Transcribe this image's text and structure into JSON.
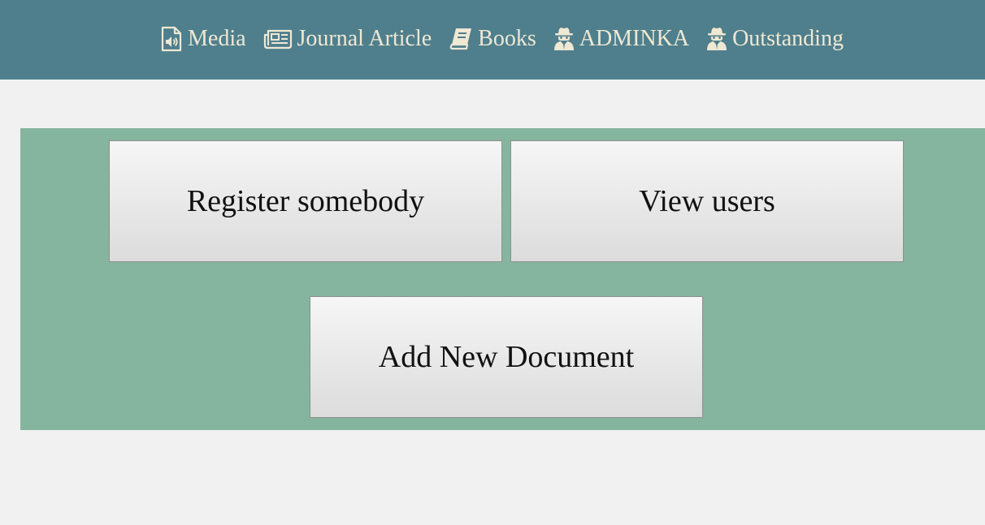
{
  "nav": {
    "items": [
      {
        "label": "Media",
        "icon": "audio-file-icon"
      },
      {
        "label": "Journal Article",
        "icon": "newspaper-icon"
      },
      {
        "label": "Books",
        "icon": "book-icon"
      },
      {
        "label": "ADMINKA",
        "icon": "user-secret-icon"
      },
      {
        "label": "Outstanding",
        "icon": "user-secret-icon"
      }
    ]
  },
  "actions": {
    "register_label": "Register somebody",
    "view_users_label": "View users",
    "add_document_label": "Add New Document"
  },
  "colors": {
    "header_bg": "#4f7f8d",
    "nav_text": "#efe8d3",
    "panel_bg": "#85b59e",
    "page_bg": "#f1f1f1"
  }
}
